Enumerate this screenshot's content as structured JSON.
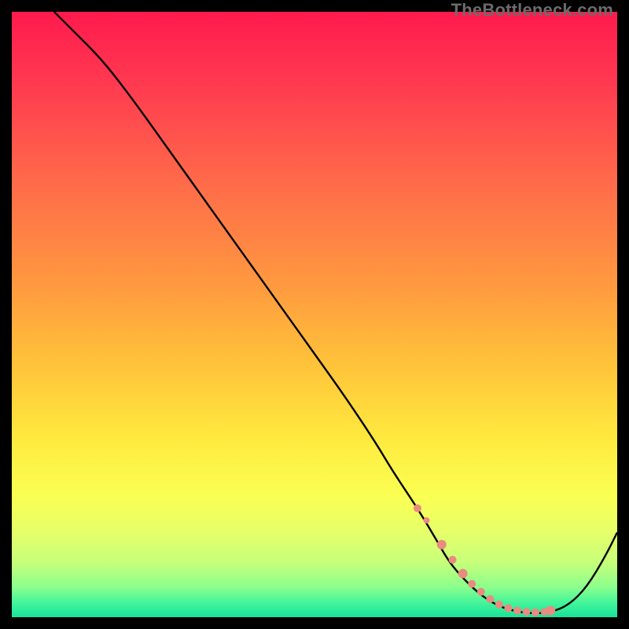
{
  "attribution": "TheBottleneck.com",
  "colors": {
    "background_black": "#000000",
    "curve_stroke": "#000000",
    "dot_fill": "#e98b80",
    "gradient_stops": [
      {
        "offset": 0.0,
        "color": "#ff1a4d"
      },
      {
        "offset": 0.12,
        "color": "#ff3a50"
      },
      {
        "offset": 0.28,
        "color": "#ff6a4a"
      },
      {
        "offset": 0.44,
        "color": "#ff9640"
      },
      {
        "offset": 0.58,
        "color": "#ffc23a"
      },
      {
        "offset": 0.7,
        "color": "#ffe83e"
      },
      {
        "offset": 0.8,
        "color": "#faff52"
      },
      {
        "offset": 0.86,
        "color": "#e6ff6a"
      },
      {
        "offset": 0.91,
        "color": "#c6ff7a"
      },
      {
        "offset": 0.95,
        "color": "#8cff8c"
      },
      {
        "offset": 0.975,
        "color": "#46f59a"
      },
      {
        "offset": 1.0,
        "color": "#17e39a"
      }
    ]
  },
  "chart_data": {
    "type": "line",
    "title": "",
    "xlabel": "",
    "ylabel": "",
    "xlim": [
      0,
      100
    ],
    "ylim": [
      0,
      100
    ],
    "grid": false,
    "legend": false,
    "series": [
      {
        "name": "bottleneck-curve",
        "x": [
          7,
          10,
          15,
          20,
          25,
          30,
          35,
          40,
          45,
          50,
          55,
          60,
          63,
          67,
          70,
          72,
          74,
          77,
          80,
          83,
          86,
          89,
          92,
          95,
          98,
          100
        ],
        "y": [
          100,
          97,
          92,
          85.5,
          78.5,
          71.5,
          64.5,
          57.5,
          50.5,
          43.5,
          36.5,
          29,
          24,
          18,
          13,
          9.5,
          7,
          4,
          2,
          1,
          0.6,
          0.8,
          2,
          5,
          10,
          14
        ]
      }
    ],
    "highlight_points": {
      "name": "sweet-spot-dots",
      "x": [
        67,
        68.5,
        71,
        72.8,
        74.5,
        76,
        77.5,
        79,
        80.5,
        82,
        83.5,
        85,
        86.5,
        88,
        89
      ],
      "y": [
        18,
        16,
        12,
        9.5,
        7.2,
        5.5,
        4.2,
        3.0,
        2.1,
        1.5,
        1.1,
        0.9,
        0.8,
        0.9,
        1.1
      ],
      "r": [
        5,
        4,
        6,
        5,
        6,
        5,
        5,
        5,
        5,
        5,
        5,
        5,
        5,
        5,
        6
      ]
    }
  }
}
